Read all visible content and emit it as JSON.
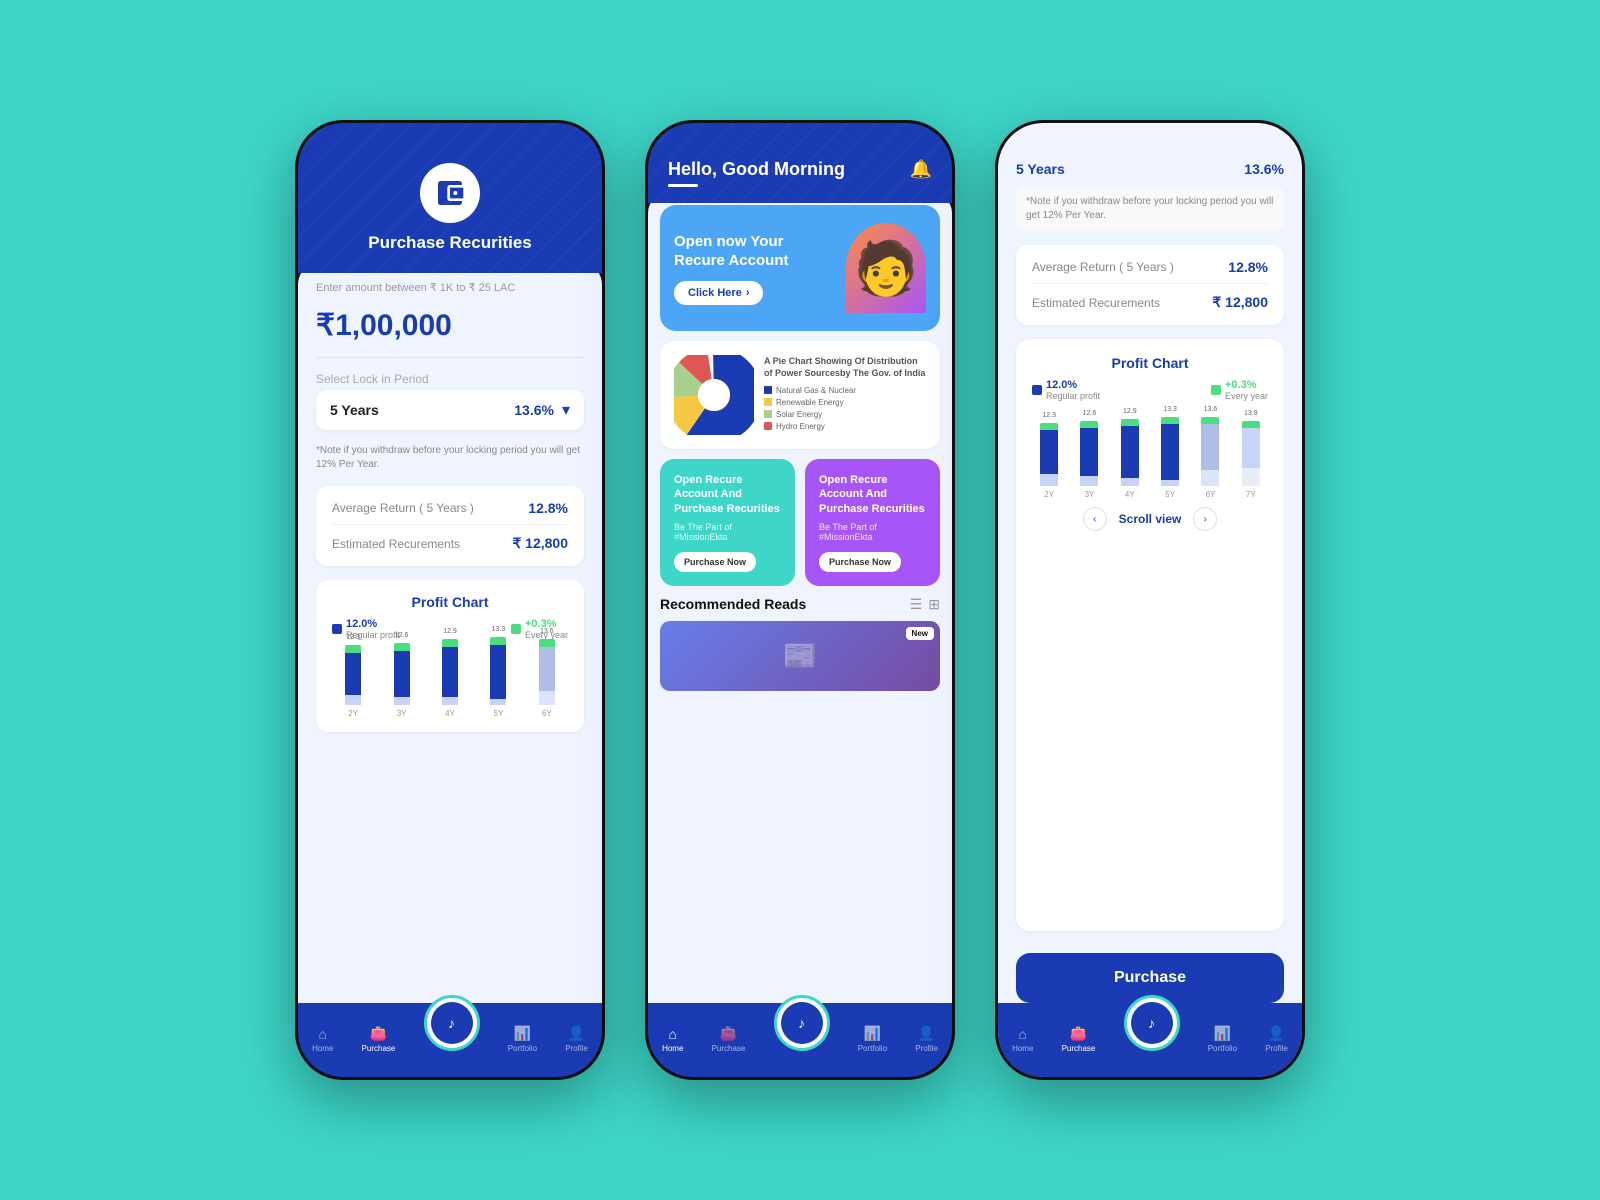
{
  "bg_color": "#3dd6c8",
  "phone1": {
    "title": "Purchase Recurities",
    "input_label": "Enter amount between ₹ 1K to ₹ 25 LAC",
    "amount": "₹1,00,000",
    "lock_label": "Select Lock in Period",
    "lock_period": "5 Years",
    "lock_rate": "13.6%",
    "chevron": "▾",
    "note": "*Note if you withdraw before your locking period you will get 12% Per Year.",
    "avg_return_label": "Average Return ( 5 Years )",
    "avg_return_value": "12.8%",
    "est_label": "Estimated Recurements",
    "est_value": "₹ 12,800",
    "profit_chart_title": "Profit Chart",
    "regular_profit_label": "Regular profit",
    "regular_profit_value": "12.0%",
    "every_year_label": "Every year",
    "every_year_value": "+0.3%",
    "bar_labels": [
      "2Y",
      "3Y",
      "4Y",
      "5Y",
      "6Y"
    ],
    "bar_top_values": [
      "12.3",
      "12.6",
      "12.9",
      "13.3",
      "13.6"
    ],
    "nav_items": [
      {
        "label": "Home",
        "icon": "⌂",
        "active": false
      },
      {
        "label": "Purchase",
        "icon": "👛",
        "active": true
      },
      {
        "label": "",
        "icon": "",
        "center": true
      },
      {
        "label": "Portfolio",
        "icon": "📊",
        "active": false
      },
      {
        "label": "Profile",
        "icon": "👤",
        "active": false
      }
    ]
  },
  "phone2": {
    "greeting": "Hello, Good Morning",
    "bell_icon": "🔔",
    "hero": {
      "title": "Open now Your\nRecure Account",
      "btn_label": "Click Here"
    },
    "pie_chart": {
      "title": "A Pie Chart Showing Of Distribution of\nPower Sourcesby The Gov. of India",
      "segments": [
        {
          "label": "Natural Gas & Nuclear",
          "color": "#1a3bb3",
          "value": 61
        },
        {
          "label": "Renewable Energy",
          "color": "#f5c842",
          "value": 15
        },
        {
          "label": "Solar Energy",
          "color": "#a8d08d",
          "value": 13
        },
        {
          "label": "Hydro Energy",
          "color": "#e05555",
          "value": 11
        }
      ]
    },
    "card1": {
      "title": "Open Recure Account And Purchase Recurities",
      "subtitle": "Be The Part of #MissionEkta",
      "btn": "Purchase Now"
    },
    "card2": {
      "title": "Open Recure Account And Purchase Recurities",
      "subtitle": "Be The Part of #MissionEkta",
      "btn": "Purchase Now"
    },
    "reads_title": "Recommended Reads",
    "new_badge": "New",
    "nav_items": [
      {
        "label": "Home",
        "icon": "⌂",
        "active": true
      },
      {
        "label": "Purchase",
        "icon": "👛",
        "active": false
      },
      {
        "label": "",
        "icon": "",
        "center": true
      },
      {
        "label": "Portfolio",
        "icon": "📊",
        "active": false
      },
      {
        "label": "Profile",
        "icon": "👤",
        "active": false
      }
    ]
  },
  "phone3": {
    "top_left": "5 Years",
    "top_right": "13.6%",
    "note": "*Note if you withdraw before your locking period you will get 12% Per Year.",
    "avg_return_label": "Average Return ( 5 Years )",
    "avg_return_value": "12.8%",
    "est_label": "Estimated Recurements",
    "est_value": "₹ 12,800",
    "profit_chart_title": "Profit Chart",
    "regular_profit_value": "12.0%",
    "regular_profit_label": "Regular profit",
    "every_year_value": "+0.3%",
    "every_year_label": "Every year",
    "bar_labels": [
      "2Y",
      "3Y",
      "4Y",
      "5Y",
      "6Y",
      "7Y"
    ],
    "bar_top_values": [
      "12.3",
      "12.6",
      "12.9",
      "13.3",
      "13.6",
      "13.9"
    ],
    "scroll_text": "Scroll view",
    "purchase_btn": "Purchase",
    "nav_items": [
      {
        "label": "Home",
        "icon": "⌂",
        "active": false
      },
      {
        "label": "Purchase",
        "icon": "👛",
        "active": true
      },
      {
        "label": "",
        "icon": "",
        "center": true
      },
      {
        "label": "Portfolio",
        "icon": "📊",
        "active": false
      },
      {
        "label": "Profile",
        "icon": "👤",
        "active": false
      }
    ]
  }
}
